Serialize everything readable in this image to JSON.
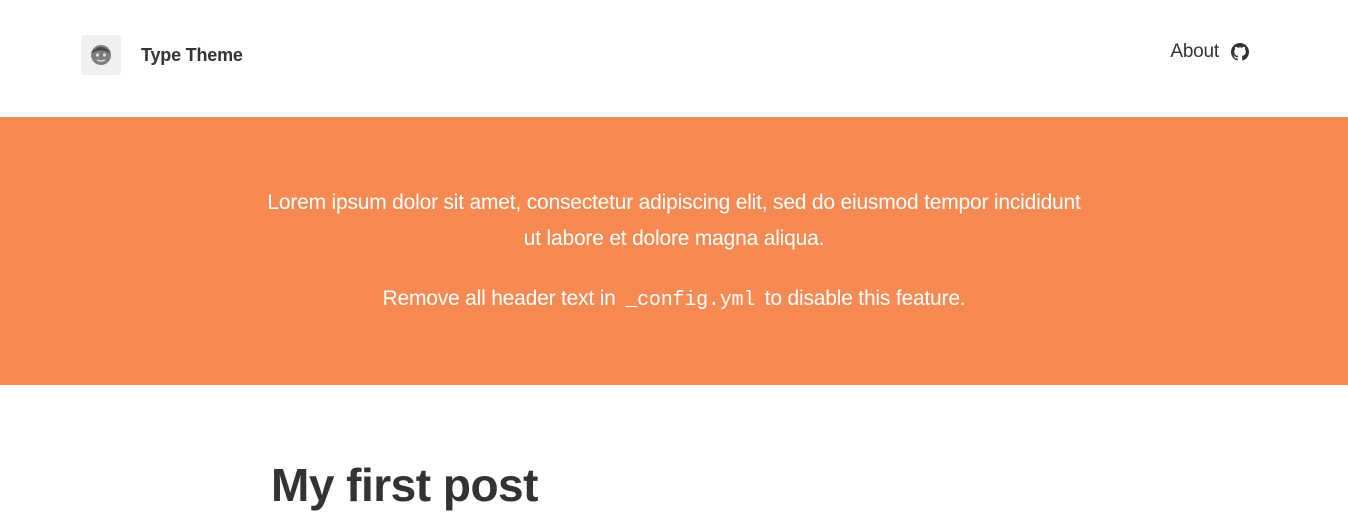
{
  "header": {
    "site_title": "Type Theme",
    "avatar_icon": "avatar-face-icon",
    "nav": [
      {
        "label": "About"
      }
    ],
    "github_icon": "github-icon"
  },
  "hero": {
    "line1": "Lorem ipsum dolor sit amet, consectetur adipiscing elit, sed do eiusmod tempor incididunt ut labore et dolore magna aliqua.",
    "line2_before": "Remove all header text in",
    "line2_code": "_config.yml",
    "line2_after": "to disable this feature.",
    "background_color": "#f68a52"
  },
  "posts": [
    {
      "title": "My first post"
    }
  ]
}
